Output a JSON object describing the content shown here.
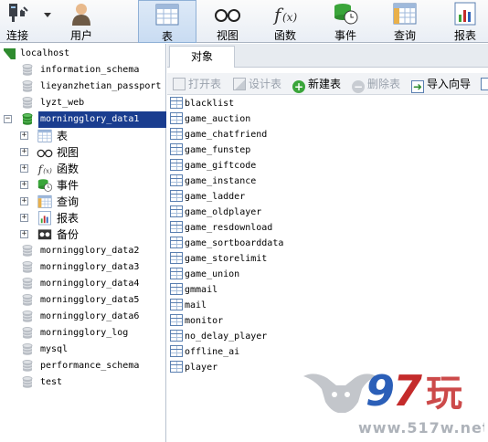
{
  "toolbar": {
    "items": [
      {
        "key": "connect",
        "label": "连接",
        "icon": "connect-plug-icon"
      },
      {
        "key": "user",
        "label": "用户",
        "icon": "user-icon"
      },
      {
        "key": "table",
        "label": "表",
        "icon": "table-icon",
        "active": true
      },
      {
        "key": "view",
        "label": "视图",
        "icon": "glasses-view-icon"
      },
      {
        "key": "function",
        "label": "函数",
        "icon": "function-fx-icon"
      },
      {
        "key": "event",
        "label": "事件",
        "icon": "clock-event-icon"
      },
      {
        "key": "query",
        "label": "查询",
        "icon": "query-grid-icon"
      },
      {
        "key": "report",
        "label": "报表",
        "icon": "report-chart-icon"
      }
    ]
  },
  "sidebar": {
    "root": "localhost",
    "databases_top": [
      "information_schema",
      "lieyanzhetian_passport",
      "lyzt_web"
    ],
    "selected_db": "morningglory_data1",
    "children": [
      {
        "label": "表",
        "icon": "table-icon"
      },
      {
        "label": "视图",
        "icon": "glasses-view-icon"
      },
      {
        "label": "函数",
        "icon": "function-fx-icon"
      },
      {
        "label": "事件",
        "icon": "clock-event-icon"
      },
      {
        "label": "查询",
        "icon": "query-grid-icon"
      },
      {
        "label": "报表",
        "icon": "report-chart-icon"
      },
      {
        "label": "备份",
        "icon": "backup-icon"
      }
    ],
    "databases_bottom": [
      "morningglory_data2",
      "morningglory_data3",
      "morningglory_data4",
      "morningglory_data5",
      "morningglory_data6",
      "morningglory_log",
      "mysql",
      "performance_schema",
      "test"
    ]
  },
  "tabs": {
    "objects": "对象"
  },
  "actions": {
    "open": "打开表",
    "design": "设计表",
    "new": "新建表",
    "delete": "删除表",
    "import": "导入向导"
  },
  "tables": [
    "blacklist",
    "game_auction",
    "game_chatfriend",
    "game_funstep",
    "game_giftcode",
    "game_instance",
    "game_ladder",
    "game_oldplayer",
    "game_resdownload",
    "game_sortboarddata",
    "game_storelimit",
    "game_union",
    "gmmail",
    "mail",
    "monitor",
    "no_delay_player",
    "offline_ai",
    "player"
  ],
  "watermark": {
    "brand": "97玩",
    "url": "www.517w.net"
  },
  "colors": {
    "selection": "#1a3d8f",
    "db_green": "#2e8b2e",
    "watermark_blue": "#2b5fb8",
    "watermark_red": "#c42b2b"
  }
}
